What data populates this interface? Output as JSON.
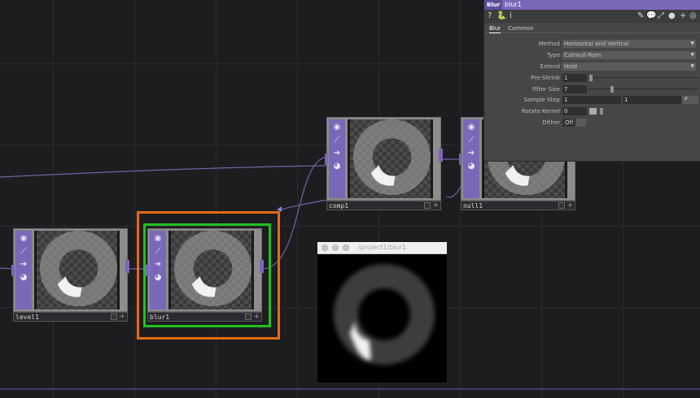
{
  "nodes": {
    "level1": {
      "name": "level1"
    },
    "blur1": {
      "name": "blur1"
    },
    "comp1": {
      "name": "comp1"
    },
    "null1": {
      "name": "null1"
    }
  },
  "node_strip_icons": [
    "viewer-icon",
    "bypass-icon",
    "arrow-icon",
    "lock-icon"
  ],
  "viewer_window": {
    "title": "/project1/blur1"
  },
  "panel": {
    "op_type": "Blur",
    "op_name": "blur1",
    "tabs": [
      "Blur",
      "Common"
    ],
    "params": {
      "method": {
        "label": "Method",
        "value": "Horizontal and Vertical"
      },
      "type": {
        "label": "Type",
        "value": "Catmull-Rom"
      },
      "extend": {
        "label": "Extend",
        "value": "Hold"
      },
      "preshrink": {
        "label": "Pre-Shrink",
        "value": "1"
      },
      "filter_size": {
        "label": "Filter Size",
        "value": "7"
      },
      "sample_step": {
        "label": "Sample Step",
        "value": "1",
        "value2": "1",
        "button": "P"
      },
      "rotate_kernel": {
        "label": "Rotate Kernel",
        "value": "0"
      },
      "dither": {
        "label": "Dither",
        "value": "Off"
      }
    }
  },
  "colors": {
    "op_purple": "#7a67b8",
    "selection_orange": "#e66a14",
    "selection_green": "#1fc21f",
    "background": "#1d1d20"
  }
}
